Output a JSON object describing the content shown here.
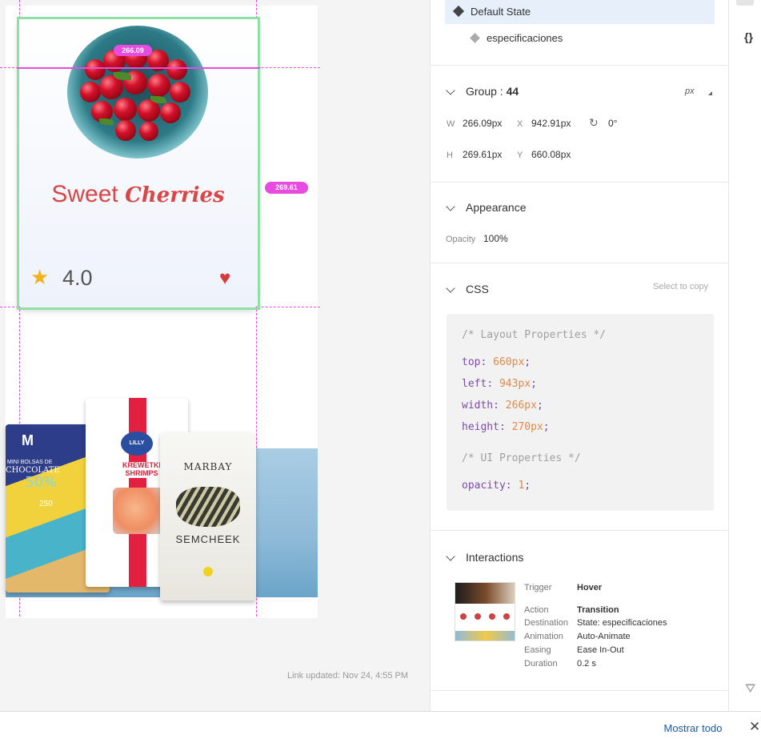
{
  "canvas": {
    "card": {
      "title_main": "Sweet",
      "title_script": "Cherries",
      "rating": "4.0"
    },
    "dimension_badges": {
      "width": "266.09",
      "height": "269.61"
    },
    "packages": {
      "chocolate": {
        "brand": "M",
        "line1": "MINI BOLSAS DE",
        "line2": "CHOCOLATE",
        "percent": "50%",
        "weight": "250"
      },
      "shrimp": {
        "logo": "LILLY",
        "name_line1": "KREWETKI",
        "name_line2": "SHRIMPS"
      },
      "seeds": {
        "brand": "MARBAY",
        "name": "SEMCHEEK"
      }
    },
    "link_updated": "Link updated: Nov 24, 4:55 PM"
  },
  "panel": {
    "states": {
      "current": "Default State",
      "child": "especificaciones"
    },
    "group": {
      "title": "Group :",
      "number": "44",
      "unit": "px",
      "w_label": "W",
      "w_value": "266.09px",
      "x_label": "X",
      "x_value": "942.91px",
      "rotation": "0°",
      "h_label": "H",
      "h_value": "269.61px",
      "y_label": "Y",
      "y_value": "660.08px"
    },
    "appearance": {
      "title": "Appearance",
      "opacity_label": "Opacity",
      "opacity_value": "100%"
    },
    "css": {
      "title": "CSS",
      "select_hint": "Select to copy",
      "layout_comment": "/* Layout Properties */",
      "lines": [
        {
          "prop": "top",
          "value": "660px"
        },
        {
          "prop": "left",
          "value": "943px"
        },
        {
          "prop": "width",
          "value": "266px"
        },
        {
          "prop": "height",
          "value": "270px"
        }
      ],
      "ui_comment": "/* UI Properties */",
      "opacity": {
        "prop": "opacity",
        "value": "1"
      }
    },
    "interactions": {
      "title": "Interactions",
      "rows": [
        {
          "label": "Trigger",
          "value": "Hover",
          "bold": true
        },
        {
          "label": "Action",
          "value": "Transition",
          "bold": true
        },
        {
          "label": "Destination",
          "value": "State: especificaciones",
          "bold": false
        },
        {
          "label": "Animation",
          "value": "Auto-Animate",
          "bold": false
        },
        {
          "label": "Easing",
          "value": "Ease In-Out",
          "bold": false
        },
        {
          "label": "Duration",
          "value": "0.2 s",
          "bold": false
        }
      ]
    }
  },
  "rail": {
    "braces": "{}"
  },
  "bottom_bar": {
    "show_all": "Mostrar todo",
    "close": "✕"
  },
  "colors": {
    "selection_green": "#8ee0a3",
    "guide_magenta": "#e84be0",
    "title_red": "#d94646",
    "star_yellow": "#f3b11b",
    "heart_red": "#d83a3a",
    "link_blue": "#1a5aa8",
    "css_property": "#7b4da8",
    "css_value": "#e8873e"
  },
  "icons": [
    "star-icon",
    "heart-icon",
    "chevron-down-icon",
    "rotate-icon",
    "diamond-state-icon",
    "braces-icon",
    "cursor-icon",
    "close-icon",
    "resize-corner-icon"
  ]
}
